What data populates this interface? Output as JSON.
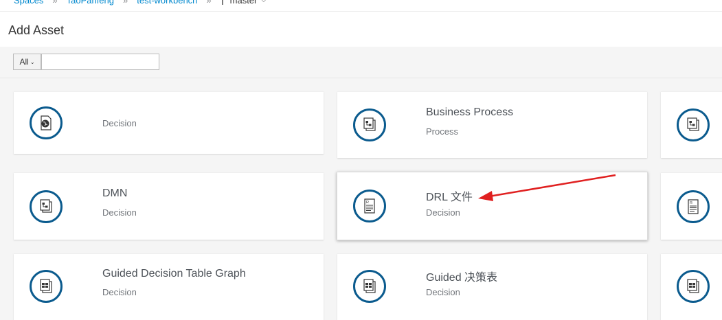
{
  "breadcrumb": {
    "spaces": "Spaces",
    "sep": "»",
    "space": "TaoPanfeng",
    "project": "test-workbench",
    "branch_icon": "branch-icon",
    "branch": "master"
  },
  "header": {
    "title": "Add Asset"
  },
  "toolbar": {
    "filter_label": "All",
    "search_value": "",
    "search_placeholder": ""
  },
  "cards": [
    {
      "name": "",
      "category": "Decision",
      "icon": "globe-document-icon"
    },
    {
      "name": "Business Process",
      "category": "Process",
      "icon": "process-diagram-icon"
    },
    {
      "name": "",
      "category": "",
      "icon": "process-diagram-icon"
    },
    {
      "name": "DMN",
      "category": "Decision",
      "icon": "process-diagram-icon"
    },
    {
      "name": "DRL 文件",
      "category": "Decision",
      "icon": "rule-file-icon"
    },
    {
      "name": "",
      "category": "",
      "icon": "rule-file-icon"
    },
    {
      "name": "Guided Decision Table Graph",
      "category": "Decision",
      "icon": "decision-table-icon"
    },
    {
      "name": "Guided 决策表",
      "category": "Decision",
      "icon": "decision-table-icon"
    },
    {
      "name": "",
      "category": "",
      "icon": "decision-table-icon"
    }
  ],
  "annotation": {
    "color": "#e02020",
    "target": "DRL 文件"
  },
  "colors": {
    "accent": "#0088ce",
    "icon_ring": "#0b5b8e"
  }
}
